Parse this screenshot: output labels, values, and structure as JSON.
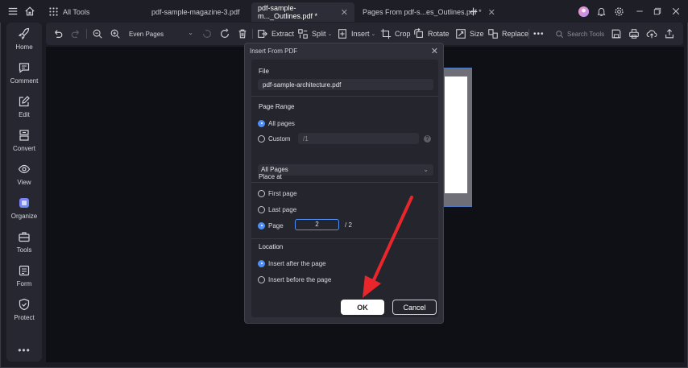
{
  "tabs": [
    {
      "label": "All Tools",
      "active": false
    },
    {
      "label": "pdf-sample-magazine-3.pdf",
      "active": false
    },
    {
      "label": "pdf-sample-m..._Outlines.pdf *",
      "active": true
    },
    {
      "label": "Pages  From  pdf-s...es_Outlines.pdf *",
      "active": false
    }
  ],
  "sidebar": {
    "items": [
      {
        "label": "Home",
        "icon": "rocket-icon"
      },
      {
        "label": "Comment",
        "icon": "comment-icon"
      },
      {
        "label": "Edit",
        "icon": "edit-icon"
      },
      {
        "label": "Convert",
        "icon": "convert-icon"
      },
      {
        "label": "View",
        "icon": "eye-icon"
      },
      {
        "label": "Organize",
        "icon": "organize-icon"
      },
      {
        "label": "Tools",
        "icon": "toolbox-icon"
      },
      {
        "label": "Form",
        "icon": "form-icon"
      },
      {
        "label": "Protect",
        "icon": "shield-icon"
      }
    ],
    "more": "•••"
  },
  "toolbar": {
    "zoom_select": "Even Pages",
    "extract": "Extract",
    "split": "Split",
    "insert": "Insert",
    "crop": "Crop",
    "rotate": "Rotate",
    "size": "Size",
    "replace": "Replace",
    "more": "•••",
    "search_placeholder": "Search Tools"
  },
  "dialog": {
    "title": "Insert From PDF",
    "file_label": "File",
    "file_value": "pdf-sample-architecture.pdf",
    "page_range_label": "Page Range",
    "all_pages": "All pages",
    "custom": "Custom",
    "custom_placeholder": "/1",
    "range_dropdown": "All Pages",
    "place_at_label": "Place at",
    "first_page": "First page",
    "last_page": "Last page",
    "page": "Page",
    "page_value": "2",
    "page_total": "/  2",
    "location_label": "Location",
    "insert_after": "Insert after the page",
    "insert_before": "Insert before the page",
    "ok": "OK",
    "cancel": "Cancel"
  },
  "colors": {
    "accent": "#4f8ef7",
    "annotation_arrow": "#e8262b"
  }
}
